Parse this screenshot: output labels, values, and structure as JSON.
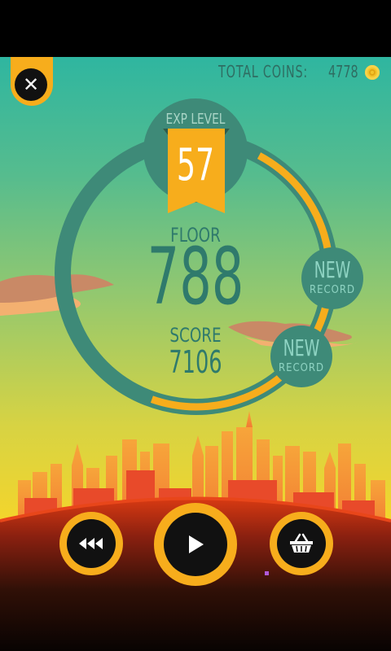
{
  "header": {
    "close_label": "✕",
    "total_coins_label": "TOTAL COINS:",
    "total_coins_value": "4778"
  },
  "stats": {
    "exp_level_label": "EXP LEVEL",
    "exp_level_value": "57",
    "exp_progress": 0.85,
    "floor_label": "FLOOR",
    "floor_value": "788",
    "score_label": "SCORE",
    "score_value": "7106"
  },
  "badges": [
    {
      "line1": "NEW",
      "line2": "RECORD"
    },
    {
      "line1": "NEW",
      "line2": "RECORD"
    }
  ],
  "controls": {
    "rewind": "rewind-icon",
    "play": "play-icon",
    "shop": "shop-basket-icon"
  },
  "colors": {
    "accent": "#f7ad1c",
    "teal": "#2f7a6c",
    "ring": "#3e8a78"
  }
}
